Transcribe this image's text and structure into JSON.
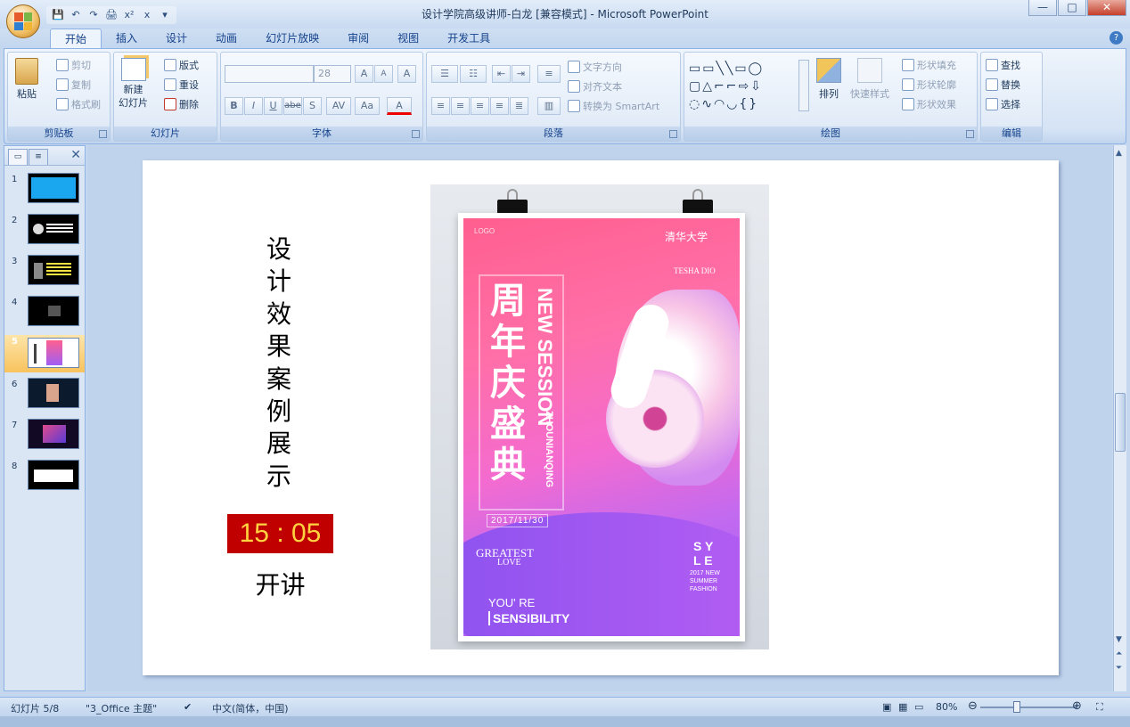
{
  "window": {
    "title": "设计学院高级讲师-白龙 [兼容模式] - Microsoft PowerPoint",
    "minimize": "—",
    "maximize": "□",
    "close": "✕"
  },
  "qat": [
    "💾",
    "↶",
    "↷",
    "🖨",
    "x²",
    "x",
    "▾"
  ],
  "tabs": [
    "开始",
    "插入",
    "设计",
    "动画",
    "幻灯片放映",
    "审阅",
    "视图",
    "开发工具"
  ],
  "help": "?",
  "ribbon": {
    "clipboard": {
      "label": "剪贴板",
      "paste": "粘贴",
      "cut": "剪切",
      "copy": "复制",
      "format_painter": "格式刷"
    },
    "slides": {
      "label": "幻灯片",
      "new_slide": "新建\n幻灯片",
      "layout": "版式",
      "reset": "重设",
      "delete": "删除"
    },
    "font": {
      "label": "字体",
      "font_name": "",
      "font_size": "28",
      "bold": "B",
      "italic": "I",
      "underline": "U",
      "strike": "abe",
      "shadow": "S",
      "spacing": "AV",
      "case": "Aa",
      "grow": "A",
      "shrink": "A",
      "clear": "A",
      "color": "A"
    },
    "paragraph": {
      "label": "段落",
      "text_direction": "文字方向",
      "align_text": "对齐文本",
      "smartart": "转换为 SmartArt"
    },
    "drawing": {
      "label": "绘图",
      "arrange": "排列",
      "quick_styles": "快速样式",
      "shape_fill": "形状填充",
      "shape_outline": "形状轮廓",
      "shape_effects": "形状效果"
    },
    "editing": {
      "label": "编辑",
      "find": "查找",
      "replace": "替换",
      "select": "选择"
    }
  },
  "slide_panel": {
    "close": "✕",
    "thumbnails": [
      {
        "num": "1"
      },
      {
        "num": "2"
      },
      {
        "num": "3"
      },
      {
        "num": "4"
      },
      {
        "num": "5"
      },
      {
        "num": "6"
      },
      {
        "num": "7"
      },
      {
        "num": "8"
      }
    ],
    "selected": 5
  },
  "slide": {
    "vertical_title": "设计效果案例展示",
    "timer": "15 : 05",
    "lecture": "开讲"
  },
  "poster": {
    "main_vertical": "周年庆盛典",
    "new_session": "NEW SESSION",
    "pinyin": "ZHOUNIANQING",
    "date": "2017/11/30",
    "greatest": "GREATEST",
    "love": "LOVE",
    "youre": "YOU' RE",
    "sensibility": "SENSIBILITY",
    "fashion_lines": "2017 NEW\nSUMMER\nFASHION",
    "sy": "S Y",
    "le": "L E",
    "tsinghua": "清华大学",
    "top_left": "LOGO",
    "tesha": "TESHA DIO"
  },
  "statusbar": {
    "slide": "幻灯片 5/8",
    "theme": "\"3_Office 主题\"",
    "language": "中文(简体，中国)",
    "zoom": "80%",
    "zoom_minus": "⊖",
    "zoom_plus": "⊕"
  },
  "colors": {
    "timer_bg": "#c00000",
    "timer_text": "#ffd23f",
    "selected_thumb": "#f8c35d"
  }
}
